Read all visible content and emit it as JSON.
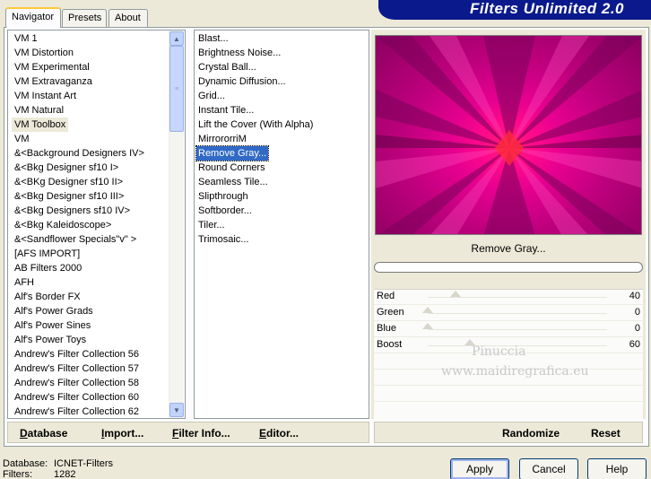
{
  "banner": {
    "title": "Filters Unlimited 2.0",
    "color": "#0a1a8c"
  },
  "tabs": [
    {
      "label": "Navigator",
      "active": true
    },
    {
      "label": "Presets",
      "active": false
    },
    {
      "label": "About",
      "active": false
    }
  ],
  "categories": [
    {
      "label": "VM 1",
      "selected": false
    },
    {
      "label": "VM Distortion",
      "selected": false
    },
    {
      "label": "VM Experimental",
      "selected": false
    },
    {
      "label": "VM Extravaganza",
      "selected": false
    },
    {
      "label": "VM Instant Art",
      "selected": false
    },
    {
      "label": "VM Natural",
      "selected": false
    },
    {
      "label": "VM Toolbox",
      "selected": true
    },
    {
      "label": "VM",
      "selected": false
    },
    {
      "label": "&<Background Designers IV>",
      "selected": false
    },
    {
      "label": "&<Bkg Designer sf10 I>",
      "selected": false
    },
    {
      "label": "&<BKg Designer sf10 II>",
      "selected": false
    },
    {
      "label": "&<Bkg Designer sf10 III>",
      "selected": false
    },
    {
      "label": "&<Bkg Designers sf10 IV>",
      "selected": false
    },
    {
      "label": "&<Bkg Kaleidoscope>",
      "selected": false
    },
    {
      "label": "&<Sandflower Specials\"v\" >",
      "selected": false
    },
    {
      "label": "[AFS IMPORT]",
      "selected": false
    },
    {
      "label": "AB Filters 2000",
      "selected": false
    },
    {
      "label": "AFH",
      "selected": false
    },
    {
      "label": "Alf's Border FX",
      "selected": false
    },
    {
      "label": "Alf's Power Grads",
      "selected": false
    },
    {
      "label": "Alf's Power Sines",
      "selected": false
    },
    {
      "label": "Alf's Power Toys",
      "selected": false
    },
    {
      "label": "Andrew's Filter Collection 56",
      "selected": false
    },
    {
      "label": "Andrew's Filter Collection 57",
      "selected": false
    },
    {
      "label": "Andrew's Filter Collection 58",
      "selected": false
    },
    {
      "label": "Andrew's Filter Collection 60",
      "selected": false
    },
    {
      "label": "Andrew's Filter Collection 62",
      "selected": false
    }
  ],
  "filters": [
    {
      "label": "Blast...",
      "selected": false
    },
    {
      "label": "Brightness Noise...",
      "selected": false
    },
    {
      "label": "Crystal Ball...",
      "selected": false
    },
    {
      "label": "Dynamic Diffusion...",
      "selected": false
    },
    {
      "label": "Grid...",
      "selected": false
    },
    {
      "label": "Instant Tile...",
      "selected": false
    },
    {
      "label": "Lift the Cover (With Alpha)",
      "selected": false
    },
    {
      "label": "MirrororriM",
      "selected": false
    },
    {
      "label": "Remove Gray...",
      "selected": true
    },
    {
      "label": "Round Corners",
      "selected": false
    },
    {
      "label": "Seamless Tile...",
      "selected": false
    },
    {
      "label": "Slipthrough",
      "selected": false
    },
    {
      "label": "Softborder...",
      "selected": false
    },
    {
      "label": "Tiler...",
      "selected": false
    },
    {
      "label": "Trimosaic...",
      "selected": false
    }
  ],
  "left_bar": {
    "database": "Database",
    "import": "Import...",
    "filter_info": "Filter Info...",
    "editor": "Editor..."
  },
  "filter_name": "Remove Gray...",
  "params": [
    {
      "label": "Red",
      "value": "40",
      "max": 255
    },
    {
      "label": "Green",
      "value": "0",
      "max": 255
    },
    {
      "label": "Blue",
      "value": "0",
      "max": 255
    },
    {
      "label": "Boost",
      "value": "60",
      "max": 255
    }
  ],
  "right_bar": {
    "randomize": "Randomize",
    "reset": "Reset"
  },
  "watermark": {
    "line1": "Pinuccia",
    "line2": "www.maidiregrafica.eu"
  },
  "status": {
    "database_label": "Database:",
    "database_value": "ICNET-Filters",
    "filters_label": "Filters:",
    "filters_value": "1282"
  },
  "dialog": {
    "apply": "Apply",
    "cancel": "Cancel",
    "help": "Help"
  }
}
